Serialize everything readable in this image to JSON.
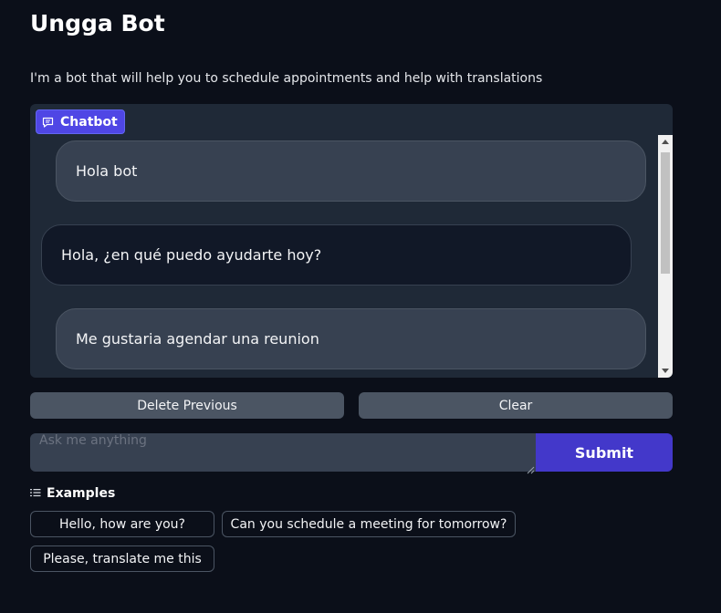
{
  "app": {
    "title": "Ungga Bot",
    "description": "I'm a bot that will help you to schedule appointments and help with translations"
  },
  "chatbot": {
    "label": "Chatbot",
    "icon": "chat-icon",
    "messages": [
      {
        "role": "user",
        "text": "Hola bot"
      },
      {
        "role": "bot",
        "text": "Hola, ¿en qué puedo ayudarte hoy?"
      },
      {
        "role": "user",
        "text": "Me gustaria agendar una reunion"
      }
    ]
  },
  "controls": {
    "delete_previous_label": "Delete Previous",
    "clear_label": "Clear"
  },
  "input": {
    "placeholder": "Ask me anything",
    "value": "",
    "submit_label": "Submit"
  },
  "examples": {
    "header": "Examples",
    "icon": "list-icon",
    "items": [
      "Hello, how are you?",
      "Can you schedule a meeting for tomorrow?",
      "Please, translate me this"
    ]
  },
  "colors": {
    "background": "#0b0f19",
    "panel": "#1f2937",
    "accent": "#4f46e5",
    "submit": "#4338ca"
  }
}
